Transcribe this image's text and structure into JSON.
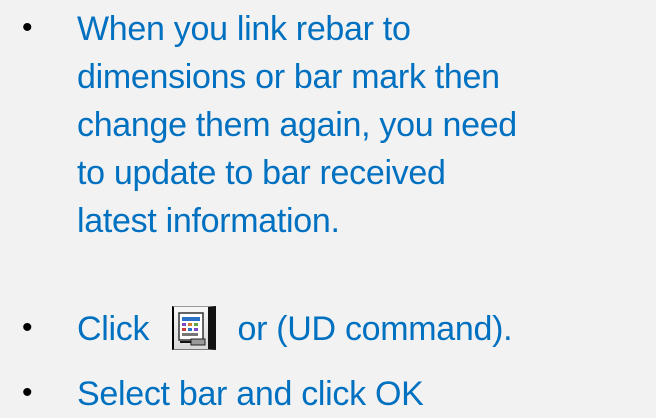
{
  "bullets": [
    {
      "lines": [
        "When you link rebar to",
        "dimensions or bar mark then",
        "change them again, you need",
        "to update to bar received",
        "latest information."
      ]
    },
    {
      "before_icon": "Click",
      "icon": "update-rebar-icon",
      "after_icon": "or (UD command)."
    },
    {
      "text": "Select bar and click OK"
    }
  ],
  "bullet_symbol": "•",
  "colors": {
    "background": "#f2f2f2",
    "text": "#0070c0",
    "bullet": "#000000"
  }
}
